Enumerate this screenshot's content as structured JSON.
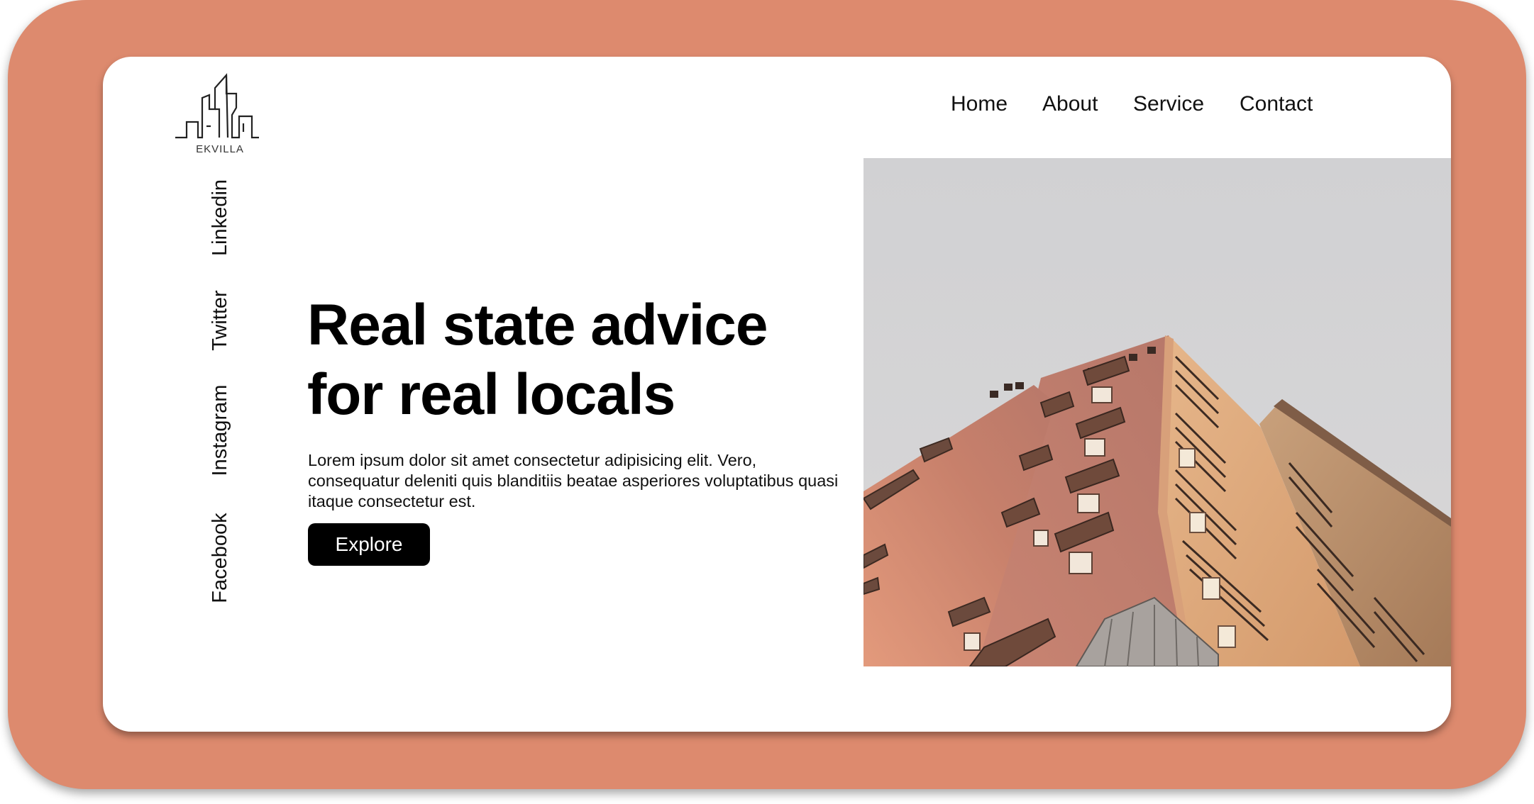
{
  "brand": {
    "name": "EKVILLA"
  },
  "nav": {
    "home": "Home",
    "about": "About",
    "service": "Service",
    "contact": "Contact"
  },
  "social": {
    "linkedin": "Linkedin",
    "twitter": "Twitter",
    "instagram": "Instagram",
    "facebook": "Facebook"
  },
  "hero": {
    "title_line1": "Real state advice",
    "title_line2": "for real locals",
    "description": "Lorem ipsum dolor sit amet consectetur adipisicing elit. Vero, consequatur deleniti quis blanditiis beatae asperiores voluptatibus quasi itaque consectetur est.",
    "cta_label": "Explore"
  },
  "colors": {
    "background": "#dd8a6e",
    "card": "#ffffff",
    "button": "#000000",
    "sky": "#d3d3d5"
  }
}
